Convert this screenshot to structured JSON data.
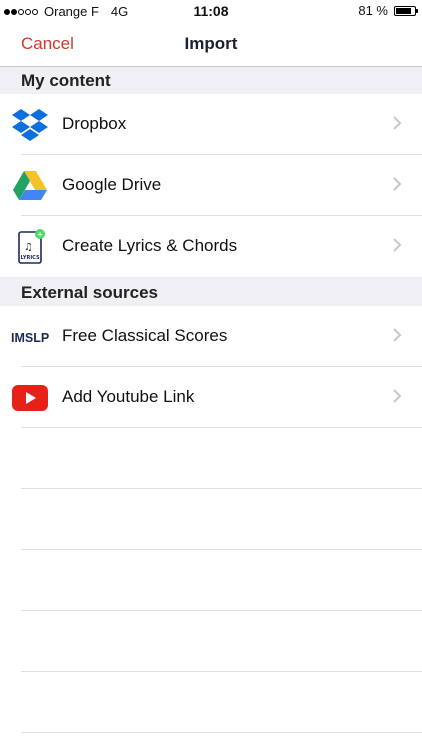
{
  "status_bar": {
    "carrier": "Orange F",
    "network": "4G",
    "time": "11:08",
    "battery_text": "81 %",
    "battery_level": 0.81,
    "signal_bars_filled": 2,
    "signal_bars_total": 5
  },
  "nav": {
    "cancel_label": "Cancel",
    "title": "Import"
  },
  "sections": {
    "my_content": {
      "header": "My content",
      "items": [
        {
          "label": "Dropbox",
          "icon": "dropbox-icon"
        },
        {
          "label": "Google Drive",
          "icon": "google-drive-icon"
        },
        {
          "label": "Create Lyrics & Chords",
          "icon": "lyrics-document-icon",
          "icon_text": "LYRICS"
        }
      ]
    },
    "external": {
      "header": "External sources",
      "items": [
        {
          "label": "Free Classical Scores",
          "icon": "imslp-logo-icon",
          "icon_text": "IMSLP"
        },
        {
          "label": "Add Youtube Link",
          "icon": "youtube-icon"
        }
      ]
    }
  },
  "colors": {
    "accent": "#d0382b",
    "section_bg": "#efeff4",
    "dropbox": "#0d6ee0",
    "youtube": "#e62117",
    "imslp": "#1c2a5a"
  }
}
